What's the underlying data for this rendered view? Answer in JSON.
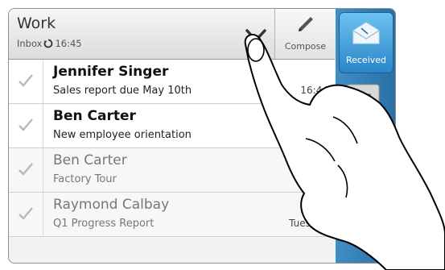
{
  "header": {
    "account": "Work",
    "folder": "Inbox",
    "sync_time": "16:45",
    "compose_label": "Compose"
  },
  "rail": {
    "received_label": "Received"
  },
  "messages": [
    {
      "sender": "Jennifer Singer",
      "subject": "Sales report due May 10th",
      "time": "16:44",
      "state": "unread"
    },
    {
      "sender": "Ben Carter",
      "subject": "New employee orientation",
      "time": "",
      "state": "unread"
    },
    {
      "sender": "Ben Carter",
      "subject": "Factory Tour",
      "time": "",
      "state": "read"
    },
    {
      "sender": "Raymond Calbay",
      "subject": "Q1 Progress Report",
      "time": "Tuesday",
      "state": "read"
    }
  ],
  "colors": {
    "accent": "#2a86c8",
    "rail": "#3f8fc6"
  },
  "icons": [
    "sync-icon",
    "chevron-down-icon",
    "pencil-icon",
    "envelope-icon",
    "checkmark-icon"
  ]
}
